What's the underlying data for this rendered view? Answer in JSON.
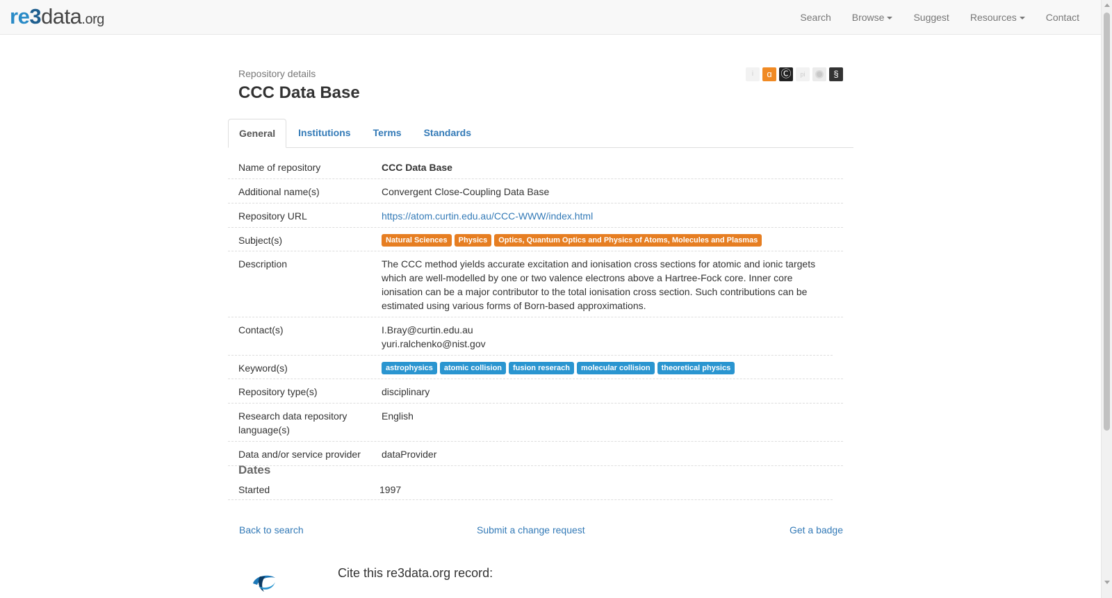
{
  "navbar": {
    "logo": {
      "re": "re",
      "three": "3",
      "data": "data",
      "org": ".org"
    },
    "items": [
      {
        "label": "Search"
      },
      {
        "label": "Browse"
      },
      {
        "label": "Suggest"
      },
      {
        "label": "Resources"
      },
      {
        "label": "Contact"
      }
    ]
  },
  "header": {
    "subtitle": "Repository details",
    "title": "CCC Data Base",
    "badges": [
      "info-icon",
      "open-access-icon",
      "copyright-icon",
      "pid-icon",
      "certificate-icon",
      "policy-icon"
    ]
  },
  "tabs": [
    {
      "label": "General",
      "active": true
    },
    {
      "label": "Institutions",
      "active": false
    },
    {
      "label": "Terms",
      "active": false
    },
    {
      "label": "Standards",
      "active": false
    }
  ],
  "details": {
    "name": {
      "label": "Name of repository",
      "value": "CCC Data Base"
    },
    "additional_names": {
      "label": "Additional name(s)",
      "value": "Convergent Close-Coupling Data Base"
    },
    "url": {
      "label": "Repository URL",
      "value": "https://atom.curtin.edu.au/CCC-WWW/index.html"
    },
    "subjects": {
      "label": "Subject(s)",
      "tags": [
        "Natural Sciences",
        "Physics",
        "Optics, Quantum Optics and Physics of Atoms, Molecules and Plasmas"
      ]
    },
    "description": {
      "label": "Description",
      "value": "The CCC method yields accurate excitation and ionisation cross sections for atomic and ionic targets which are well-modelled by one or two valence electrons above a Hartree-Fock core. Inner core ionisation can be a major contributor to the total ionisation cross section. Such contributions can be estimated using various forms of Born-based approximations."
    },
    "contacts": {
      "label": "Contact(s)",
      "values": [
        "I.Bray@curtin.edu.au",
        "yuri.ralchenko@nist.gov"
      ]
    },
    "keywords": {
      "label": "Keyword(s)",
      "tags": [
        "astrophysics",
        "atomic collision",
        "fusion reserach",
        "molecular collision",
        "theoretical physics"
      ]
    },
    "repo_type": {
      "label": "Repository type(s)",
      "value": "disciplinary"
    },
    "language": {
      "label": "Research data repository language(s)",
      "value": "English"
    },
    "provider": {
      "label": "Data and/or service provider",
      "value": "dataProvider"
    }
  },
  "dates": {
    "heading": "Dates",
    "started_label": "Started",
    "started_value": "1997"
  },
  "actions": {
    "back": "Back to search",
    "change": "Submit a change request",
    "badge": "Get a badge"
  },
  "cite": {
    "text": "Cite this re3data.org record:"
  }
}
